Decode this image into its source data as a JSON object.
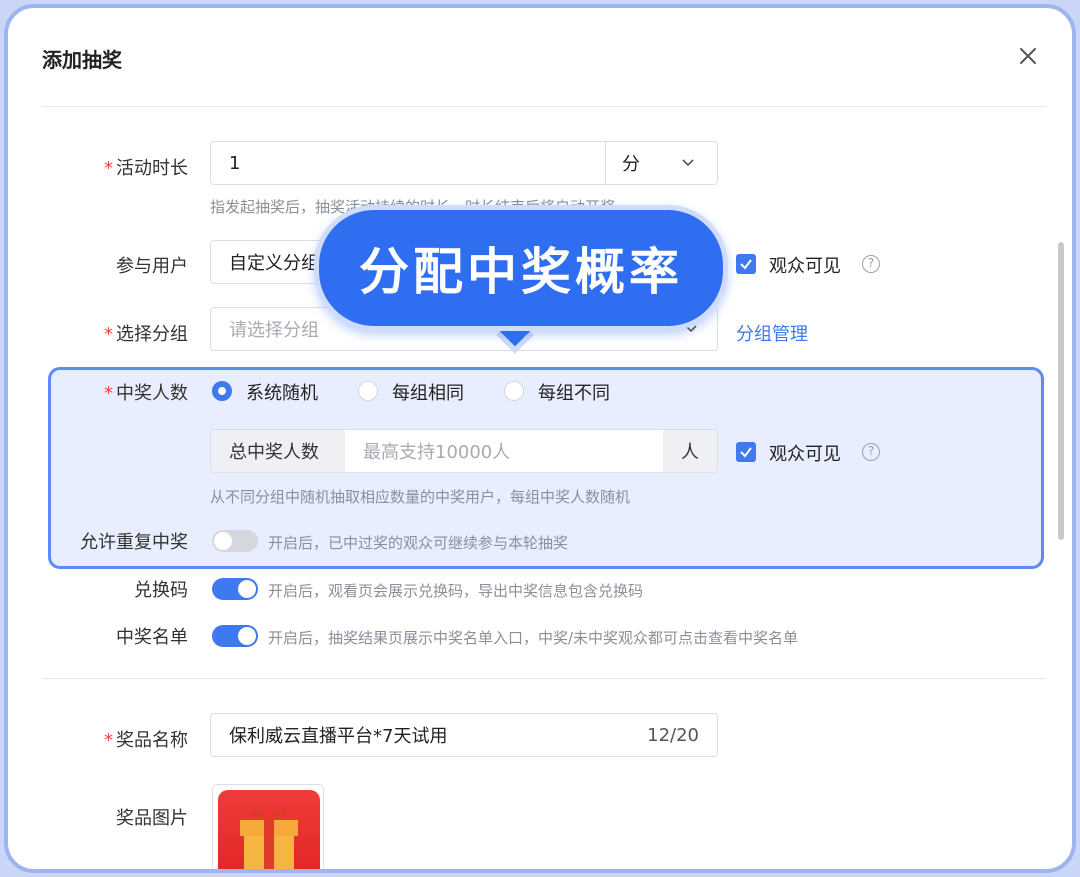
{
  "dialog": {
    "title": "添加抽奖"
  },
  "fields": {
    "duration": {
      "label": "活动时长",
      "value": "1",
      "unit": "分",
      "hint": "指发起抽奖后，抽奖活动持续的时长，时长结束后将自动开奖"
    },
    "participants": {
      "label": "参与用户",
      "value": "自定义分组",
      "visible_label": "观众可见"
    },
    "group": {
      "label": "选择分组",
      "placeholder": "请选择分组",
      "manage_link": "分组管理"
    },
    "winners": {
      "label": "中奖人数",
      "options": [
        "系统随机",
        "每组相同",
        "每组不同"
      ],
      "selected": "系统随机",
      "total_prefix": "总中奖人数",
      "total_placeholder": "最高支持10000人",
      "total_suffix": "人",
      "visible_label": "观众可见",
      "hint": "从不同分组中随机抽取相应数量的中奖用户，每组中奖人数随机"
    },
    "allow_repeat": {
      "label": "允许重复中奖",
      "enabled": false,
      "hint": "开启后，已中过奖的观众可继续参与本轮抽奖"
    },
    "redeem_code": {
      "label": "兑换码",
      "enabled": true,
      "hint": "开启后，观看页会展示兑换码，导出中奖信息包含兑换码"
    },
    "winner_list": {
      "label": "中奖名单",
      "enabled": true,
      "hint": "开启后，抽奖结果页展示中奖名单入口，中奖/未中奖观众都可点击查看中奖名单"
    },
    "prize_name": {
      "label": "奖品名称",
      "value": "保利威云直播平台*7天试用",
      "count": "12/20"
    },
    "prize_image": {
      "label": "奖品图片"
    }
  },
  "callout": {
    "text": "分配中奖概率"
  },
  "colors": {
    "accent": "#3f79f0",
    "required": "#f53f3f",
    "callout": "#2f6ef0"
  }
}
